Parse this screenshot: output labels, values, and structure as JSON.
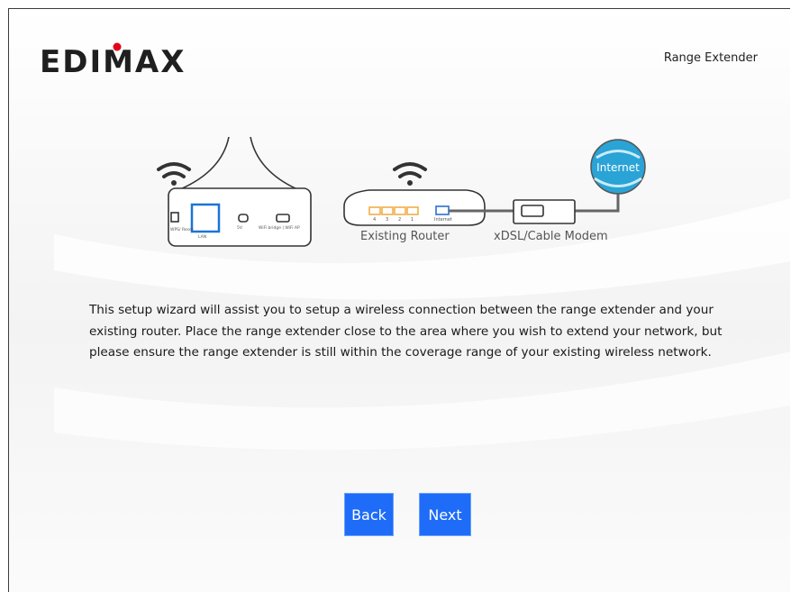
{
  "header": {
    "logo_text": "EDIMAX",
    "product_name": "Range Extender"
  },
  "diagram": {
    "extender_ports": [
      "WPS/ Reset",
      "LAN",
      "5V",
      "WiFi bridge | WiFi AP"
    ],
    "router_ports": [
      "4",
      "3",
      "2",
      "1",
      "Internet"
    ],
    "router_label": "Existing Router",
    "modem_label": "xDSL/Cable Modem",
    "globe_label": "Internet"
  },
  "intro_text": "This setup wizard will assist you to setup a wireless connection between the range extender and your existing router. Place the range extender close to the area where you wish to extend your network, but please ensure the range extender is still within the coverage range of your existing wireless network.",
  "buttons": {
    "back_label": "Back",
    "next_label": "Next"
  },
  "colors": {
    "button_bg": "#1e6cf7",
    "logo_dot": "#e2001a",
    "lan_port": "#1a74d6",
    "router_ports": "#f2a93b",
    "internet_port": "#2b6fd6",
    "globe": "#2aa3d6"
  }
}
